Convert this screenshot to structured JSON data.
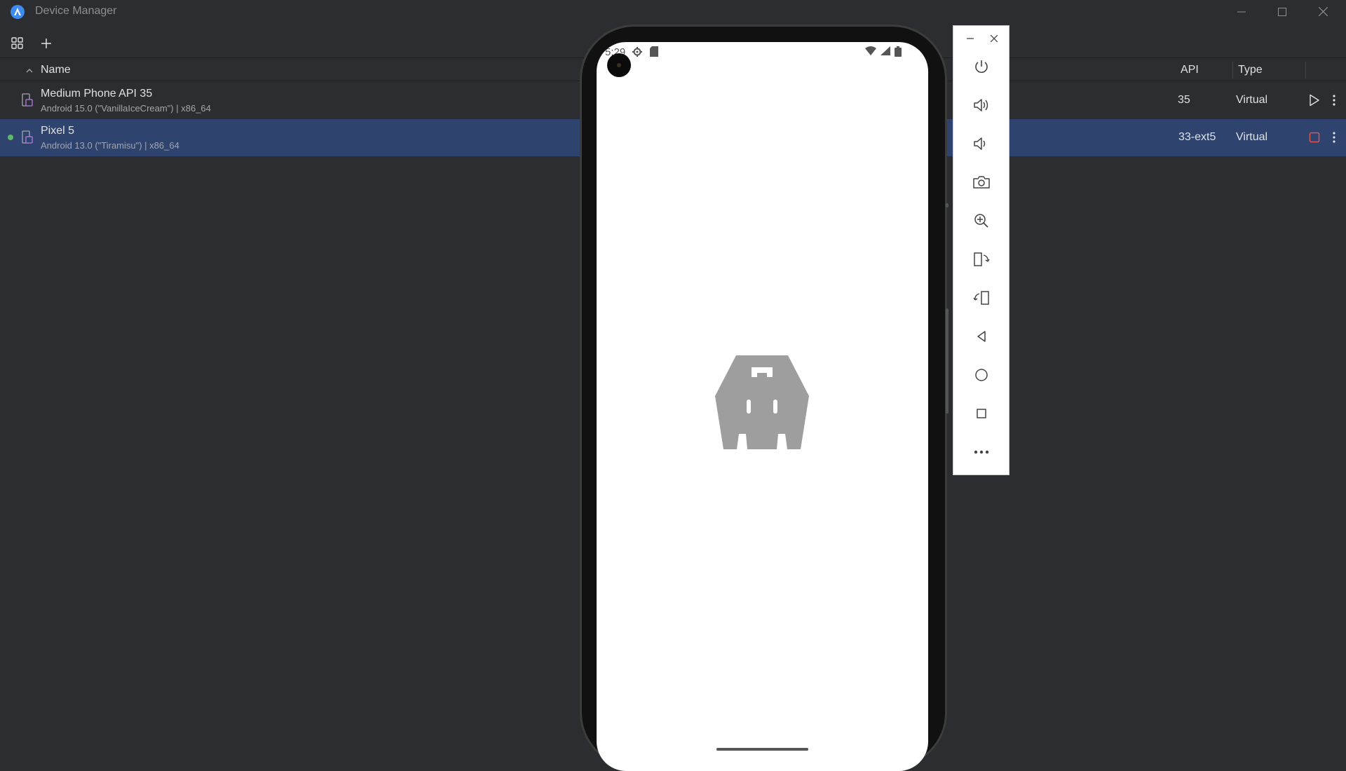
{
  "window": {
    "title": "Device Manager"
  },
  "table": {
    "columns": {
      "name": "Name",
      "api": "API",
      "type": "Type"
    },
    "rows": [
      {
        "name": "Medium Phone API 35",
        "subtitle": "Android 15.0 (\"VanillaIceCream\") | x86_64",
        "api": "35",
        "type": "Virtual",
        "action": "play-icon",
        "running": false,
        "selected": false
      },
      {
        "name": "Pixel 5",
        "subtitle": "Android 13.0 (\"Tiramisu\") | x86_64",
        "api": "33-ext5",
        "type": "Virtual",
        "action": "stop-icon",
        "running": true,
        "selected": true
      }
    ]
  },
  "emulator": {
    "status_time": "5:29",
    "screen_content": "cordova-logo",
    "panel_buttons": [
      "power-icon",
      "volume-up-icon",
      "volume-down-icon",
      "screenshot-icon",
      "zoom-icon",
      "rotate-left-icon",
      "rotate-right-icon",
      "back-icon",
      "home-icon",
      "overview-icon",
      "more-icon"
    ]
  },
  "colors": {
    "background": "#2b2d30",
    "selected_row": "#2e436e",
    "running_dot": "#5fb865",
    "stop_button": "#e05555",
    "accent": "#3d8bf0"
  }
}
